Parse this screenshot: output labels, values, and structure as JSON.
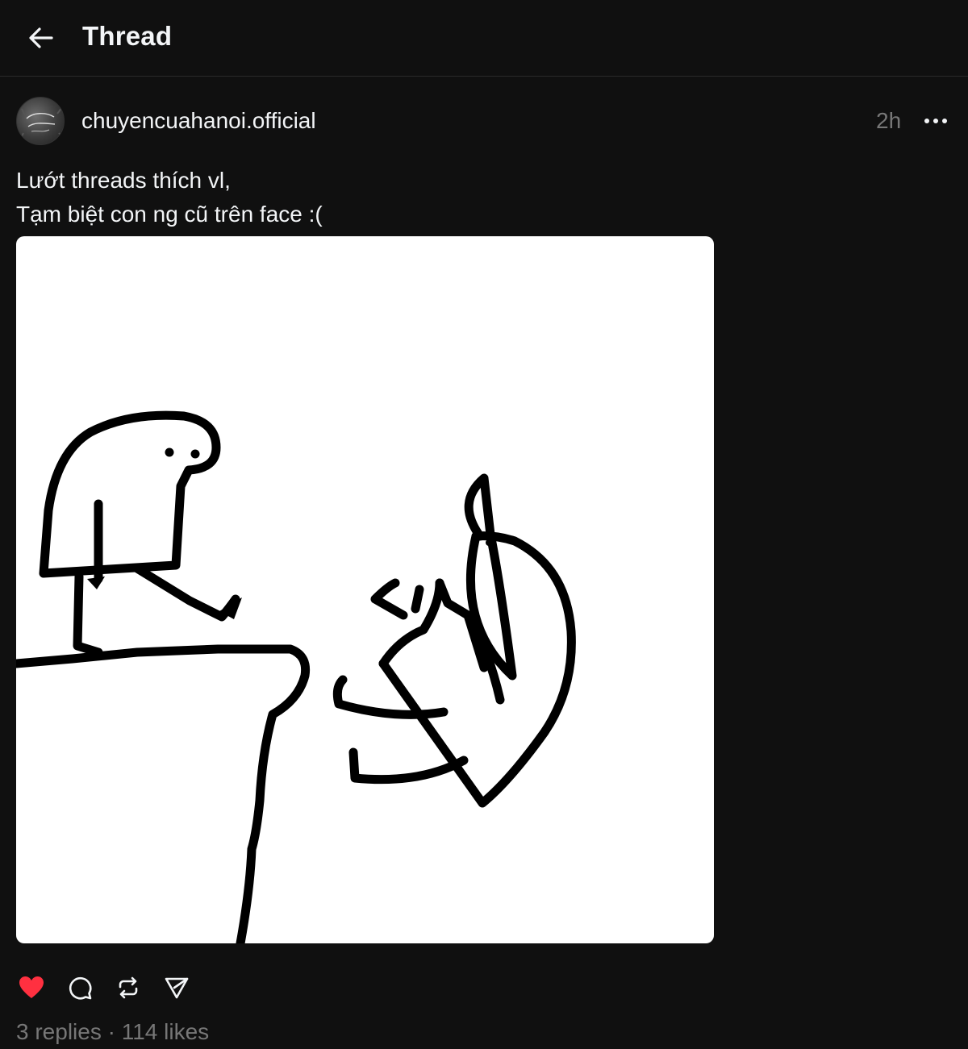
{
  "header": {
    "title": "Thread",
    "back_icon": "arrow-left-icon"
  },
  "post": {
    "author": "chuyencuahanoi.official",
    "timestamp": "2h",
    "text_lines": [
      "Lướt threads thích vl,",
      "Tạm biệt con ng cũ trên face :("
    ],
    "image_alt": "stick figure drawing",
    "liked": true,
    "like_color": "#ff3040",
    "stats": {
      "replies": "3 replies",
      "separator": "·",
      "likes": "114 likes"
    }
  },
  "icons": {
    "like": "heart-icon",
    "reply": "comment-icon",
    "repost": "repost-icon",
    "share": "send-icon",
    "more": "more-icon"
  }
}
